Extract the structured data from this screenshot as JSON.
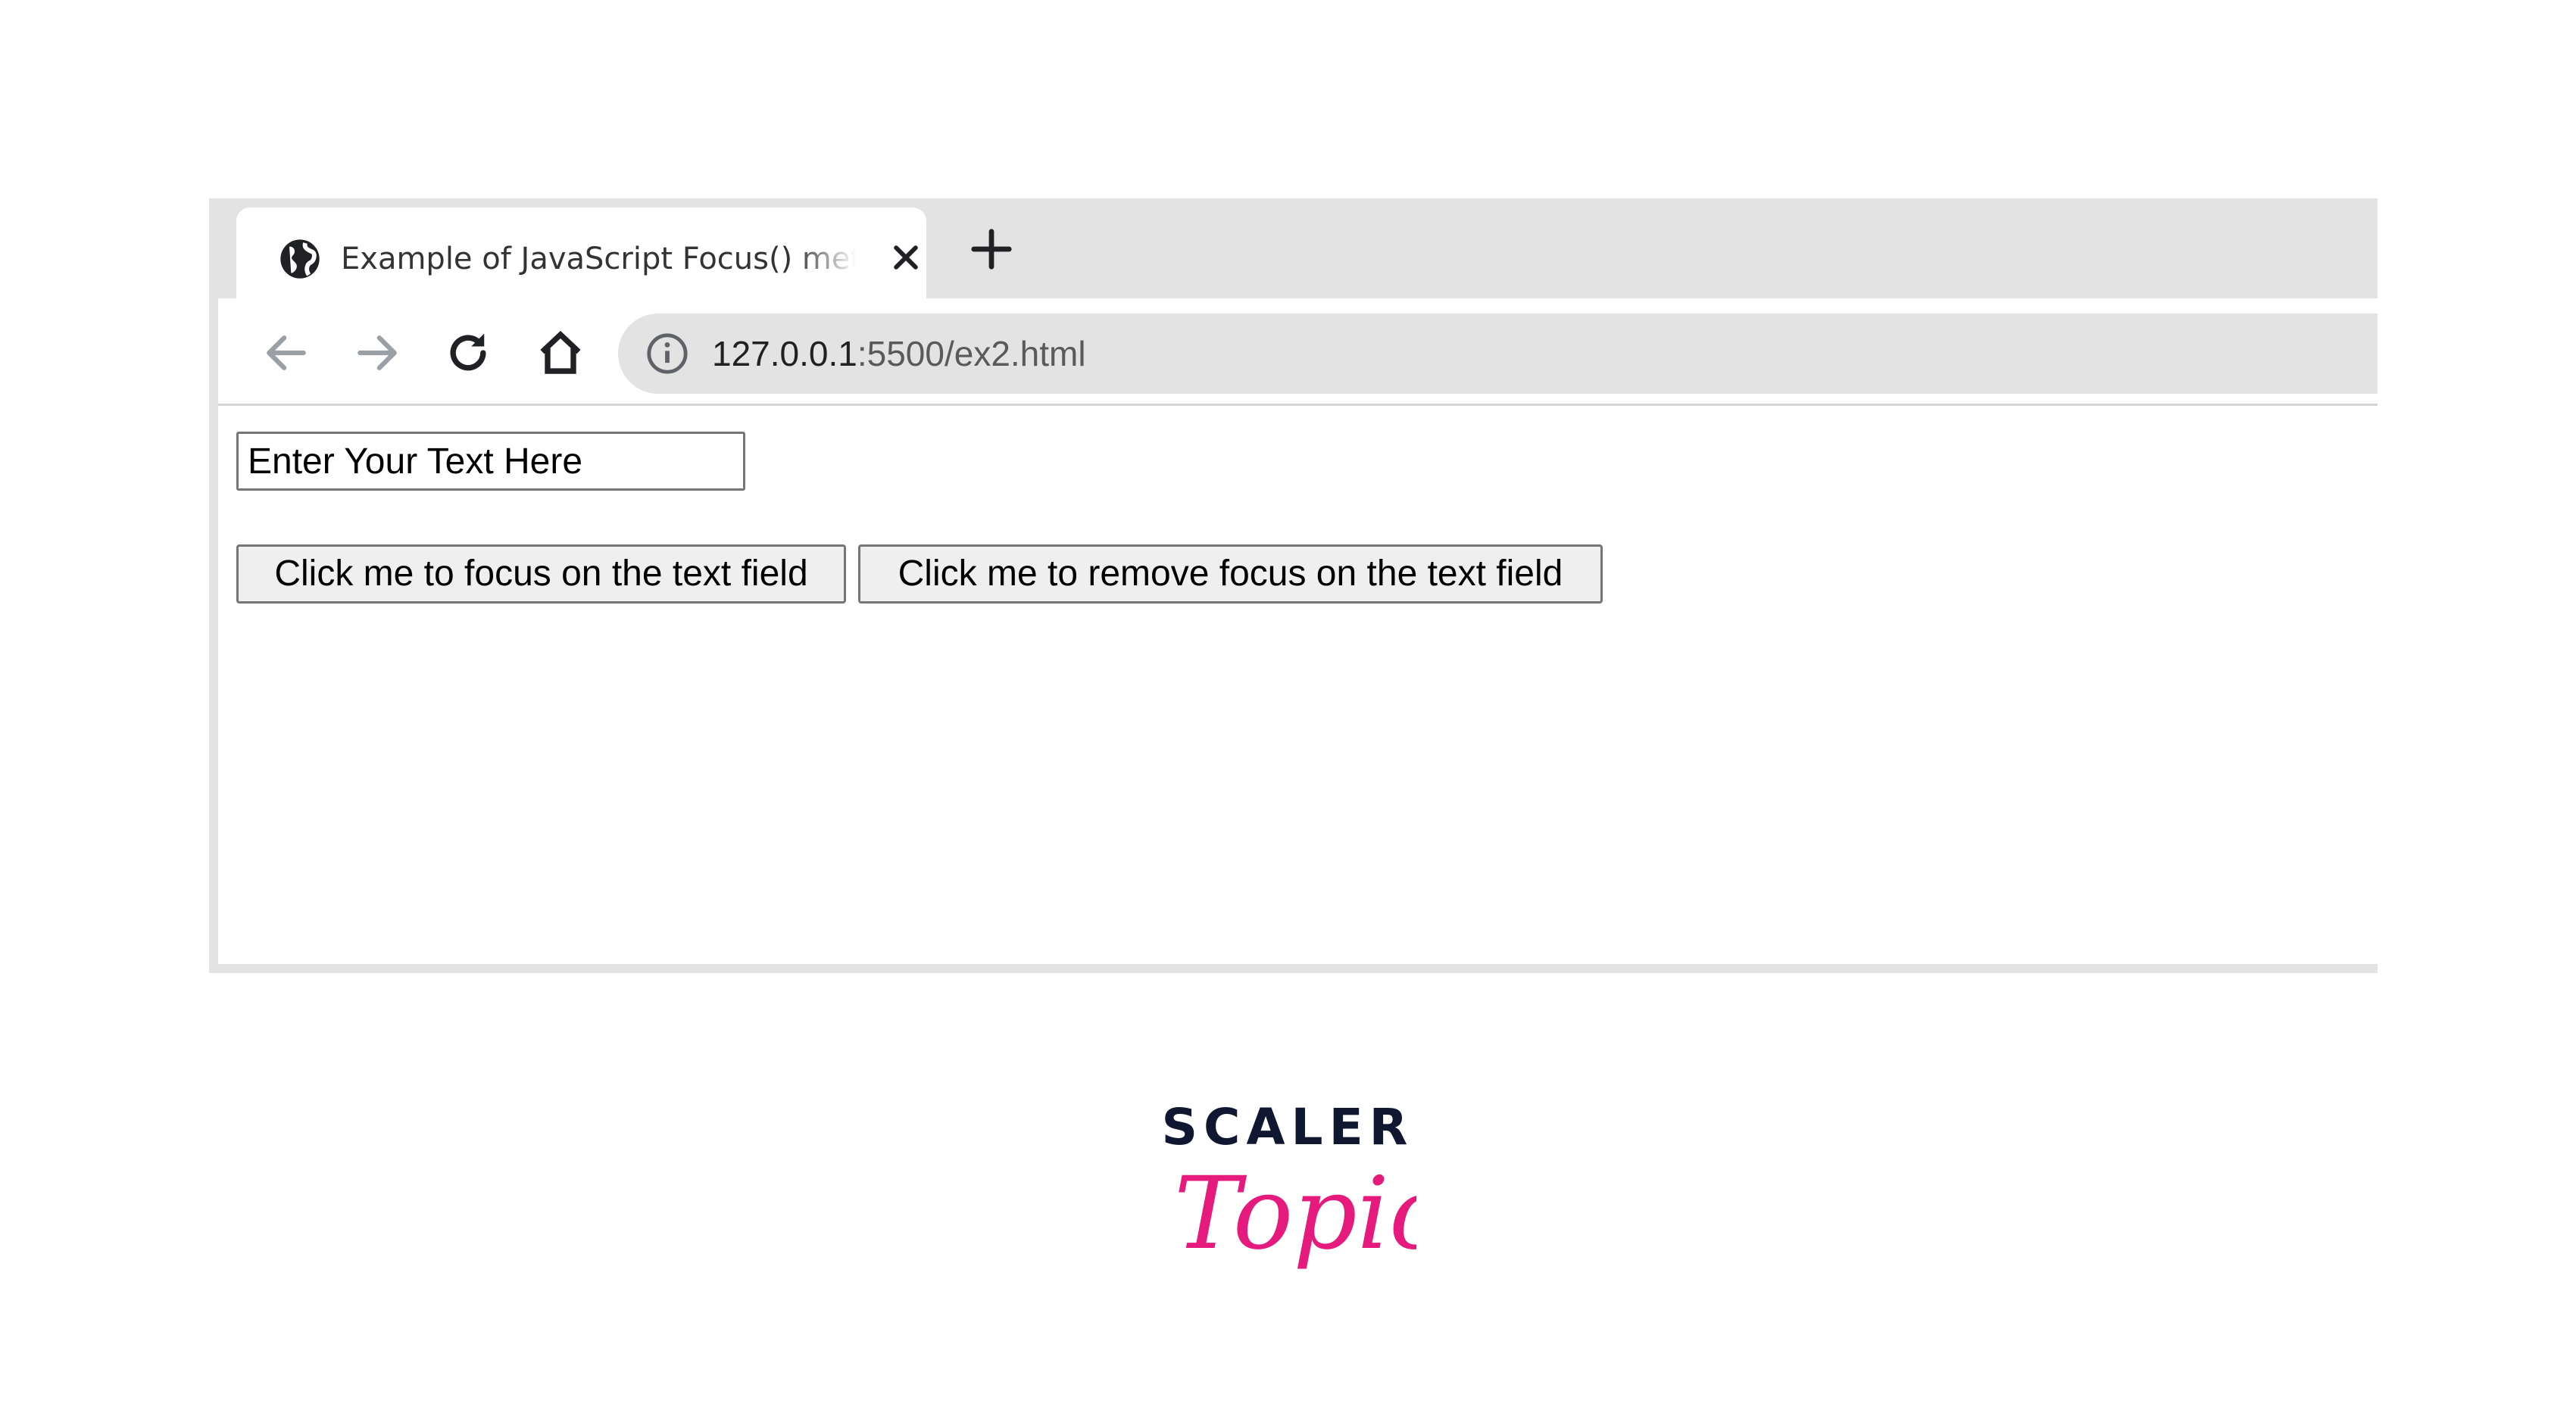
{
  "browser": {
    "tab": {
      "title": "Example of JavaScript Focus() method",
      "icon": "globe-icon"
    },
    "toolbar": {
      "url_host": "127.0.0.1",
      "url_path": ":5500/ex2.html"
    }
  },
  "content": {
    "input": {
      "value": "Enter Your Text Here"
    },
    "buttons": {
      "focus_label": "Click me to focus on the text field",
      "blur_label": "Click me to remove focus on the text field"
    }
  },
  "logo": {
    "top": "SCALER",
    "script": "Topics"
  },
  "colors": {
    "chrome_bg": "#e3e3e3",
    "logo_navy": "#0f1830",
    "logo_pink": "#e6197d"
  }
}
